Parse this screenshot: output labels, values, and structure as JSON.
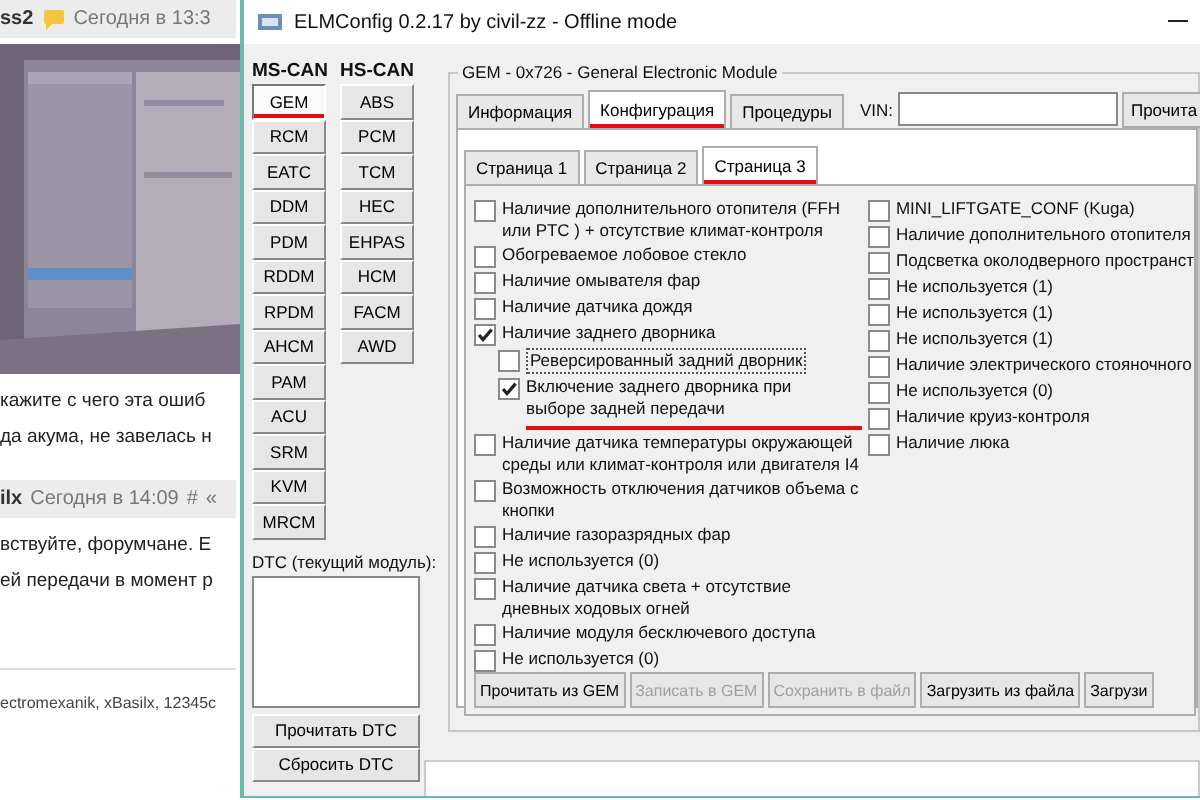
{
  "forum": {
    "posts": [
      {
        "author": "ss2",
        "time": "Сегодня в 13:3",
        "lines": [
          "кажите с чего эта ошиб",
          "да акума, не завелась н"
        ],
        "has_picture": true
      },
      {
        "author": "ilx",
        "time": "Сегодня в 14:09",
        "actions": [
          "#",
          "«"
        ],
        "lines": [
          "вствуйте, форумчане. Е",
          "ей передачи в момент р"
        ],
        "has_picture": false
      }
    ],
    "footer": "ectromexanik, xBasilx, 12345c"
  },
  "window": {
    "title": "ELMConfig 0.2.17 by civil-zz - Offline mode"
  },
  "ms_can": {
    "label": "MS-CAN",
    "modules": [
      {
        "label": "GEM",
        "selected": true,
        "underlined": true
      },
      {
        "label": "RCM",
        "selected": false,
        "underlined": false
      },
      {
        "label": "EATC",
        "selected": false,
        "underlined": false
      },
      {
        "label": "DDM",
        "selected": false,
        "underlined": false
      },
      {
        "label": "PDM",
        "selected": false,
        "underlined": false
      },
      {
        "label": "RDDM",
        "selected": false,
        "underlined": false
      },
      {
        "label": "RPDM",
        "selected": false,
        "underlined": false
      },
      {
        "label": "AHCM",
        "selected": false,
        "underlined": false
      },
      {
        "label": "PAM",
        "selected": false,
        "underlined": false
      },
      {
        "label": "ACU",
        "selected": false,
        "underlined": false
      },
      {
        "label": "SRM",
        "selected": false,
        "underlined": false
      },
      {
        "label": "KVM",
        "selected": false,
        "underlined": false
      },
      {
        "label": "MRCM",
        "selected": false,
        "underlined": false
      }
    ]
  },
  "hs_can": {
    "label": "HS-CAN",
    "modules": [
      {
        "label": "ABS",
        "selected": false,
        "underlined": false
      },
      {
        "label": "PCM",
        "selected": false,
        "underlined": false
      },
      {
        "label": "TCM",
        "selected": false,
        "underlined": false
      },
      {
        "label": "HEC",
        "selected": false,
        "underlined": false
      },
      {
        "label": "EHPAS",
        "selected": false,
        "underlined": false
      },
      {
        "label": "HCM",
        "selected": false,
        "underlined": false
      },
      {
        "label": "FACM",
        "selected": false,
        "underlined": false
      },
      {
        "label": "AWD",
        "selected": false,
        "underlined": false
      }
    ]
  },
  "dtc": {
    "label": "DTC (текущий модуль):",
    "buttons": [
      "Прочитать DTC",
      "Сбросить DTC"
    ]
  },
  "module_group": {
    "title": "GEM - 0x726 - General Electronic Module"
  },
  "tabs": [
    {
      "label": "Информация",
      "selected": false,
      "underlined": false
    },
    {
      "label": "Конфигурация",
      "selected": true,
      "underlined": true
    },
    {
      "label": "Процедуры",
      "selected": false,
      "underlined": false
    }
  ],
  "vin": {
    "label": "VIN:",
    "button": "Прочита"
  },
  "pages": [
    {
      "label": "Страница 1",
      "selected": false,
      "underlined": false
    },
    {
      "label": "Страница 2",
      "selected": false,
      "underlined": false
    },
    {
      "label": "Страница 3",
      "selected": true,
      "underlined": true
    }
  ],
  "options_left": [
    {
      "label": "Наличие дополнительного отопителя (FFH или PTC ) + отсутствие климат-контроля",
      "checked": false
    },
    {
      "label": "Обогреваемое лобовое стекло",
      "checked": false
    },
    {
      "label": "Наличие омывателя фар",
      "checked": false
    },
    {
      "label": "Наличие датчика дождя",
      "checked": false
    },
    {
      "label": "Наличие заднего дворника",
      "checked": true,
      "children": [
        {
          "label": "Реверсированный задний дворник",
          "checked": false,
          "focused": true,
          "underlined": false
        },
        {
          "label": "Включение заднего дворника при выборе задней передачи",
          "checked": true,
          "focused": false,
          "underlined": true
        }
      ]
    },
    {
      "label": "Наличие датчика температуры окружающей среды или климат-контроля или двигателя I4",
      "checked": false
    },
    {
      "label": "Возможность отключения датчиков объема с кнопки",
      "checked": false
    },
    {
      "label": "Наличие газоразрядных фар",
      "checked": false
    },
    {
      "label": "Не используется (0)",
      "checked": false
    },
    {
      "label": "Наличие датчика света + отсутствие дневных ходовых огней",
      "checked": false
    },
    {
      "label": "Наличие модуля бесключевого доступа",
      "checked": false
    },
    {
      "label": "Не используется (0)",
      "checked": false
    }
  ],
  "options_right": [
    {
      "label": "MINI_LIFTGATE_CONF (Kuga)",
      "checked": false
    },
    {
      "label": "Наличие дополнительного отопителя",
      "checked": false
    },
    {
      "label": "Подсветка околодверного пространст",
      "checked": false
    },
    {
      "label": "Не используется (1)",
      "checked": false
    },
    {
      "label": "Не используется (1)",
      "checked": false
    },
    {
      "label": "Не используется (1)",
      "checked": false
    },
    {
      "label": "Наличие электрического стояночного",
      "checked": false
    },
    {
      "label": "Не используется (0)",
      "checked": false
    },
    {
      "label": "Наличие круиз-контроля",
      "checked": false
    },
    {
      "label": "Наличие люка",
      "checked": false
    }
  ],
  "actions": [
    {
      "label": "Прочитать из GEM",
      "disabled": false
    },
    {
      "label": "Записать в GEM",
      "disabled": true
    },
    {
      "label": "Сохранить в файл",
      "disabled": true
    },
    {
      "label": "Загрузить из файла",
      "disabled": false
    },
    {
      "label": "Загрузи",
      "disabled": false
    }
  ]
}
